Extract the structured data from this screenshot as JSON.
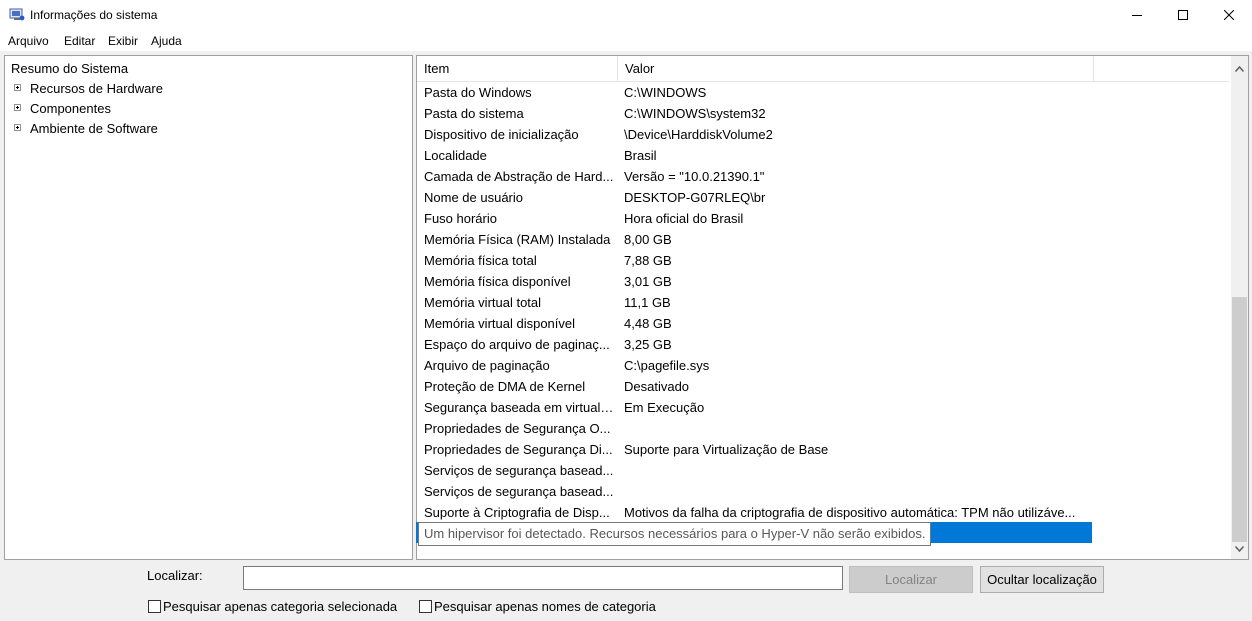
{
  "window": {
    "title": "Informações do sistema",
    "icon": "system-information-icon",
    "controls": [
      "minimize-icon",
      "maximize-icon",
      "close-icon"
    ]
  },
  "menu": [
    "Arquivo",
    "Editar",
    "Exibir",
    "Ajuda"
  ],
  "tree": [
    {
      "label": "Resumo do Sistema",
      "expandable": false
    },
    {
      "label": "Recursos de Hardware",
      "expandable": true
    },
    {
      "label": "Componentes",
      "expandable": true
    },
    {
      "label": "Ambiente de Software",
      "expandable": true
    }
  ],
  "list": {
    "headers": [
      "Item",
      "Valor"
    ],
    "rows": [
      [
        "Pasta do Windows",
        "C:\\WINDOWS"
      ],
      [
        "Pasta do sistema",
        "C:\\WINDOWS\\system32"
      ],
      [
        "Dispositivo de inicialização",
        "\\Device\\HarddiskVolume2"
      ],
      [
        "Localidade",
        "Brasil"
      ],
      [
        "Camada de Abstração de Hard...",
        "Versão = \"10.0.21390.1\""
      ],
      [
        "Nome de usuário",
        "DESKTOP-G07RLEQ\\br"
      ],
      [
        "Fuso horário",
        "Hora oficial do Brasil"
      ],
      [
        "Memória Física (RAM) Instalada",
        "8,00 GB"
      ],
      [
        "Memória física total",
        "7,88 GB"
      ],
      [
        "Memória física disponível",
        "3,01 GB"
      ],
      [
        "Memória virtual total",
        "11,1 GB"
      ],
      [
        "Memória virtual disponível",
        "4,48 GB"
      ],
      [
        "Espaço do arquivo de paginaç...",
        "3,25 GB"
      ],
      [
        "Arquivo de paginação",
        "C:\\pagefile.sys"
      ],
      [
        "Proteção de DMA de Kernel",
        "Desativado"
      ],
      [
        "Segurança baseada em virtuali...",
        "Em Execução"
      ],
      [
        "Propriedades de Segurança O...",
        ""
      ],
      [
        "Propriedades de Segurança Di...",
        "Suporte para Virtualização de Base"
      ],
      [
        "Serviços de segurança basead...",
        ""
      ],
      [
        "Serviços de segurança basead...",
        ""
      ],
      [
        "Suporte à Criptografia de Disp...",
        "Motivos da falha da criptografia de dispositivo automática: TPM não utilizáve..."
      ]
    ],
    "tooltip": "Um hipervisor foi detectado. Recursos necessários para o Hyper-V não serão exibidos.",
    "scroll_position": 1.0,
    "selection_color": "#0078d7"
  },
  "search": {
    "label": "Localizar:",
    "value": "",
    "find_button": "Localizar",
    "hide_button": "Ocultar localização",
    "checkbox_selected_category": "Pesquisar apenas categoria selecionada",
    "checkbox_category_names": "Pesquisar apenas nomes de categoria"
  }
}
